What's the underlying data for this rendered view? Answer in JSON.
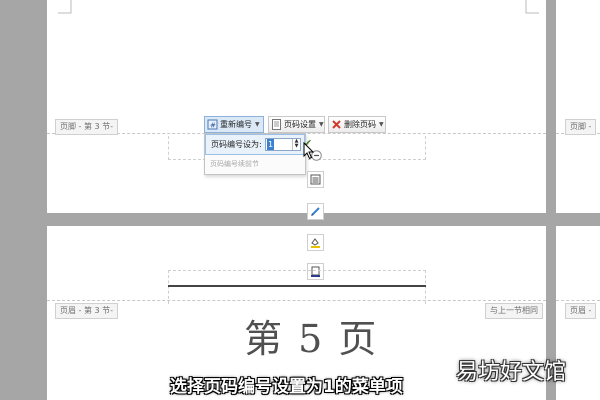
{
  "footer_label": "页脚 - 第 3 节-",
  "footer_label_right": "页脚 -",
  "header_label": "页眉 - 第 3 节-",
  "header_label_right": "页眉 -",
  "same_as_previous": "与上一节相同",
  "toolbar": {
    "renumber_label": "重新编号",
    "page_settings_label": "页码设置",
    "delete_label": "删除页码"
  },
  "dropdown": {
    "set_label": "页码编号设为:",
    "value": "1",
    "continue_label": "页码编号续前节"
  },
  "page_number_text": "第 5 页",
  "subtitle": "选择页码编号设置为1的菜单项",
  "watermark": "易坊好文馆",
  "colors": {
    "canvas": "#a6a6a6",
    "page": "#ffffff",
    "accent": "#3b7fd1",
    "check": "#4a7d2a",
    "delete_x": "#d23a2a"
  },
  "icons": {
    "renumber": "renumber-icon",
    "page_settings": "page-settings-icon",
    "delete": "delete-icon",
    "minus": "minus-circle-icon",
    "side": [
      "align-icon",
      "pen-icon",
      "fill-icon",
      "border-icon"
    ]
  }
}
